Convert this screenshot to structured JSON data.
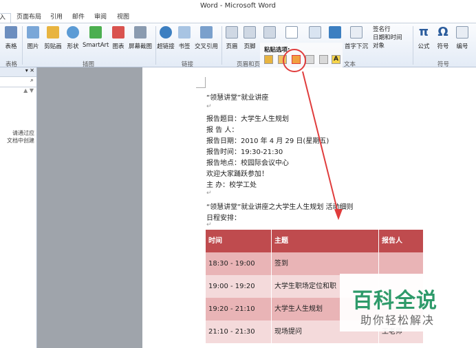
{
  "window": {
    "title": "Word - Microsoft Word"
  },
  "tabs": [
    "入",
    "页面布局",
    "引用",
    "邮件",
    "审阅",
    "视图"
  ],
  "ribbon": {
    "buttons": [
      "表格",
      "图片",
      "剪贴画",
      "形状",
      "SmartArt",
      "图表",
      "屏幕截图",
      "超链接",
      "书签",
      "交叉引用",
      "页眉",
      "页脚",
      "签名行",
      "日期和时间",
      "对象",
      "首字下沉",
      "公式",
      "符号",
      "编号"
    ],
    "groups": [
      "表格",
      "插图",
      "链接",
      "页眉和页",
      "文本",
      "符号"
    ],
    "paste_label": "粘贴选项:",
    "paste_text_a": "A"
  },
  "nav": {
    "close": "▾ ✕",
    "search_icon": "⌕",
    "arrows": "▲ ▼",
    "text1": "请通过应",
    "text2": "文档中创建"
  },
  "doc": {
    "heading": "“领慧讲堂”就业讲座",
    "topic": "报告题目：大学生人生规划",
    "speaker": "报 告 人：",
    "date": "报告日期：2010 年 4 月 29 日(星期五)",
    "time": "报告时间：19:30-21:30",
    "place": "报告地点：校园际会议中心",
    "welcome": "欢迎大家踊跃参加！",
    "host": "主 办：校学工处",
    "rules": "“领慧讲堂”就业讲座之大学生人生规划 活动细则",
    "schedule": "日程安排：",
    "para_mark": "↵"
  },
  "table": {
    "headers": [
      "时间",
      "主题",
      "报告人"
    ],
    "rows": [
      [
        "18:30 - 19:00",
        "签到",
        ""
      ],
      [
        "19:00 - 19:20",
        "大学生职场定位和职",
        ""
      ],
      [
        "19:20 - 21:10",
        "大学生人生规划",
        ""
      ],
      [
        "21:10 - 21:30",
        "现场提问",
        "王老师"
      ]
    ]
  },
  "watermark": {
    "main": "百科全说",
    "sub": "助你轻松解决"
  },
  "colors": {
    "accent": "#e03c3c",
    "header": "#bf4b4e",
    "watermark": "#2e9a6a"
  }
}
